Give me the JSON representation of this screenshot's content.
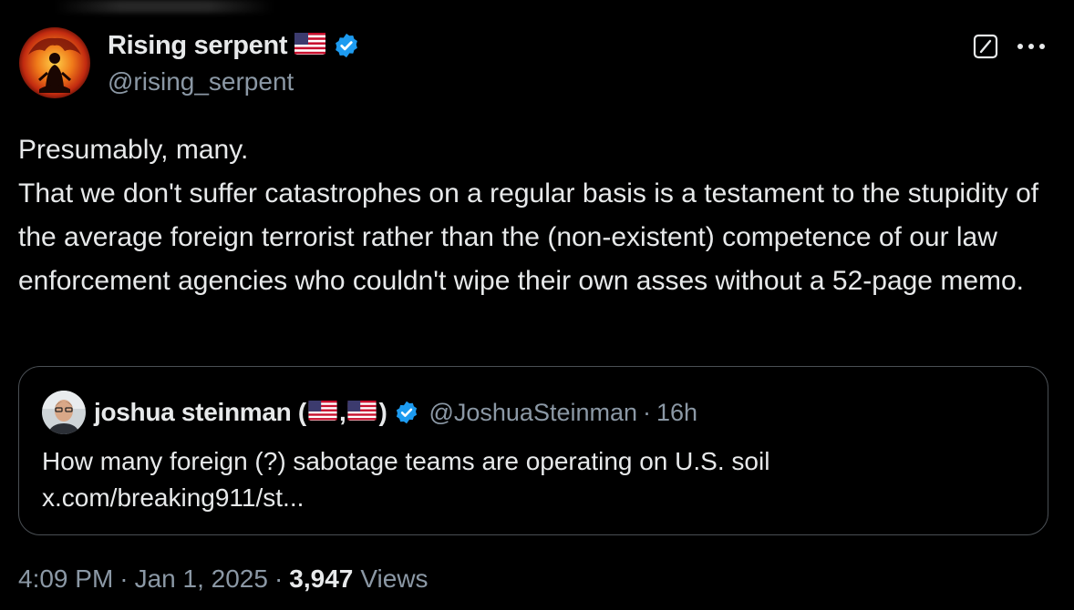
{
  "author": {
    "display_name": "Rising serpent",
    "handle": "@rising_serpent",
    "flag_icon": "us-flag-icon",
    "verified_icon": "verified-badge-icon"
  },
  "actions": {
    "grok_icon": "grok-icon",
    "more_icon": "more-options-icon"
  },
  "tweet": {
    "text": "Presumably, many.\nThat we don't suffer catastrophes on a regular basis is a testament to the stupidity of the average foreign terrorist rather than the (non-existent) competence of our law enforcement agencies who couldn't wipe their own asses without a 52-page memo."
  },
  "quoted": {
    "name_prefix": "joshua steinman (",
    "name_comma": ",",
    "name_suffix": ")",
    "handle": "@JoshuaSteinman",
    "separator": "·",
    "time": "16h",
    "text_line1": "How many foreign (?) sabotage teams are operating on U.S. soil",
    "text_line2": "x.com/breaking911/st..."
  },
  "meta": {
    "time": "4:09 PM",
    "separator": "·",
    "date": "Jan 1, 2025",
    "views_count": "3,947",
    "views_label": "Views"
  },
  "colors": {
    "background": "#000000",
    "text_primary": "#e7e9ea",
    "text_secondary": "#8b98a5",
    "verified_blue": "#1d9bf0",
    "card_border": "#4a4f54"
  }
}
